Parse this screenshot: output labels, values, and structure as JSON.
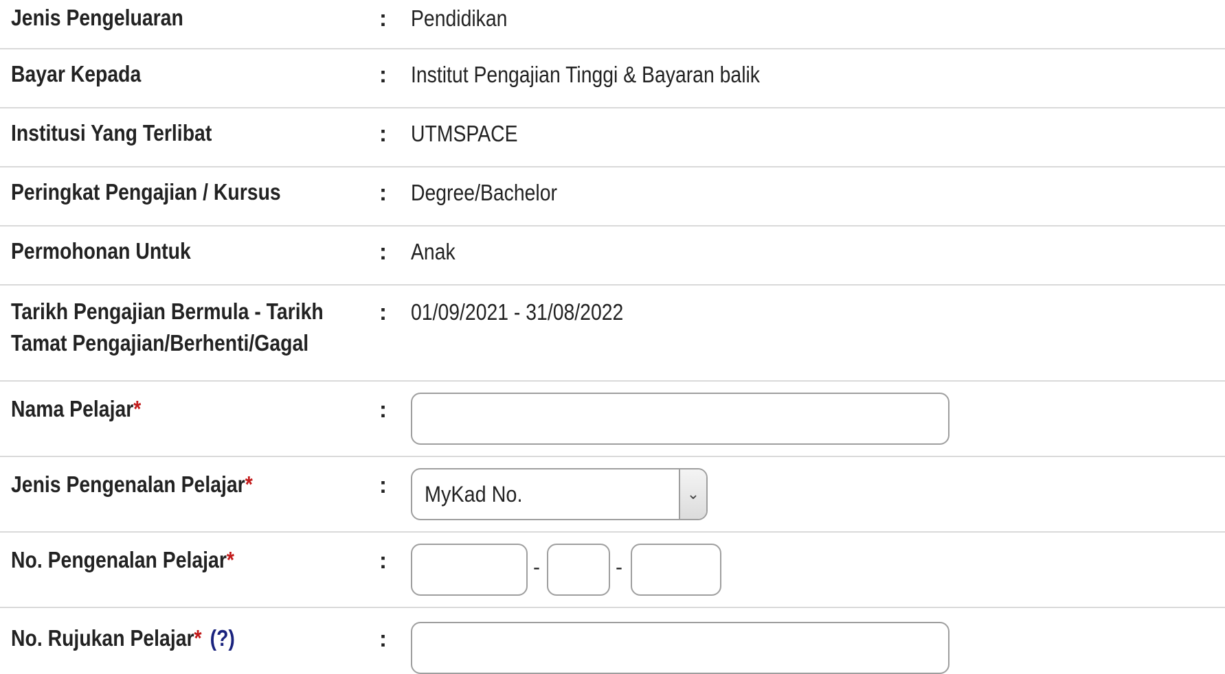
{
  "rows": [
    {
      "label": "Jenis Pengeluaran",
      "value": "Pendidikan"
    },
    {
      "label": "Bayar Kepada",
      "value": "Institut Pengajian Tinggi & Bayaran balik"
    },
    {
      "label": "Institusi Yang Terlibat",
      "value": "UTMSPACE"
    },
    {
      "label": "Peringkat Pengajian / Kursus",
      "value": "Degree/Bachelor"
    },
    {
      "label": "Permohonan Untuk",
      "value": "Anak"
    },
    {
      "label_line1": "Tarikh Pengajian Bermula - Tarikh",
      "label_line2": "Tamat Pengajian/Berhenti/Gagal",
      "value": "01/09/2021 - 31/08/2022"
    }
  ],
  "separator": ":",
  "required_mark": "*",
  "student_name": {
    "label": "Nama Pelajar",
    "value": ""
  },
  "id_type": {
    "label": "Jenis Pengenalan Pelajar",
    "selected": "MyKad No.",
    "dropdown_icon": "chevron-down-icon"
  },
  "id_number": {
    "label": "No. Pengenalan Pelajar",
    "part1": "",
    "part2": "",
    "part3": "",
    "dash": "-"
  },
  "reference_no": {
    "label": "No. Rujukan Pelajar",
    "help": "(?)",
    "value": ""
  },
  "colors": {
    "required": "#c21a1a",
    "help": "#1a237e",
    "border": "#9e9e9e",
    "divider": "#d9d9d9"
  }
}
